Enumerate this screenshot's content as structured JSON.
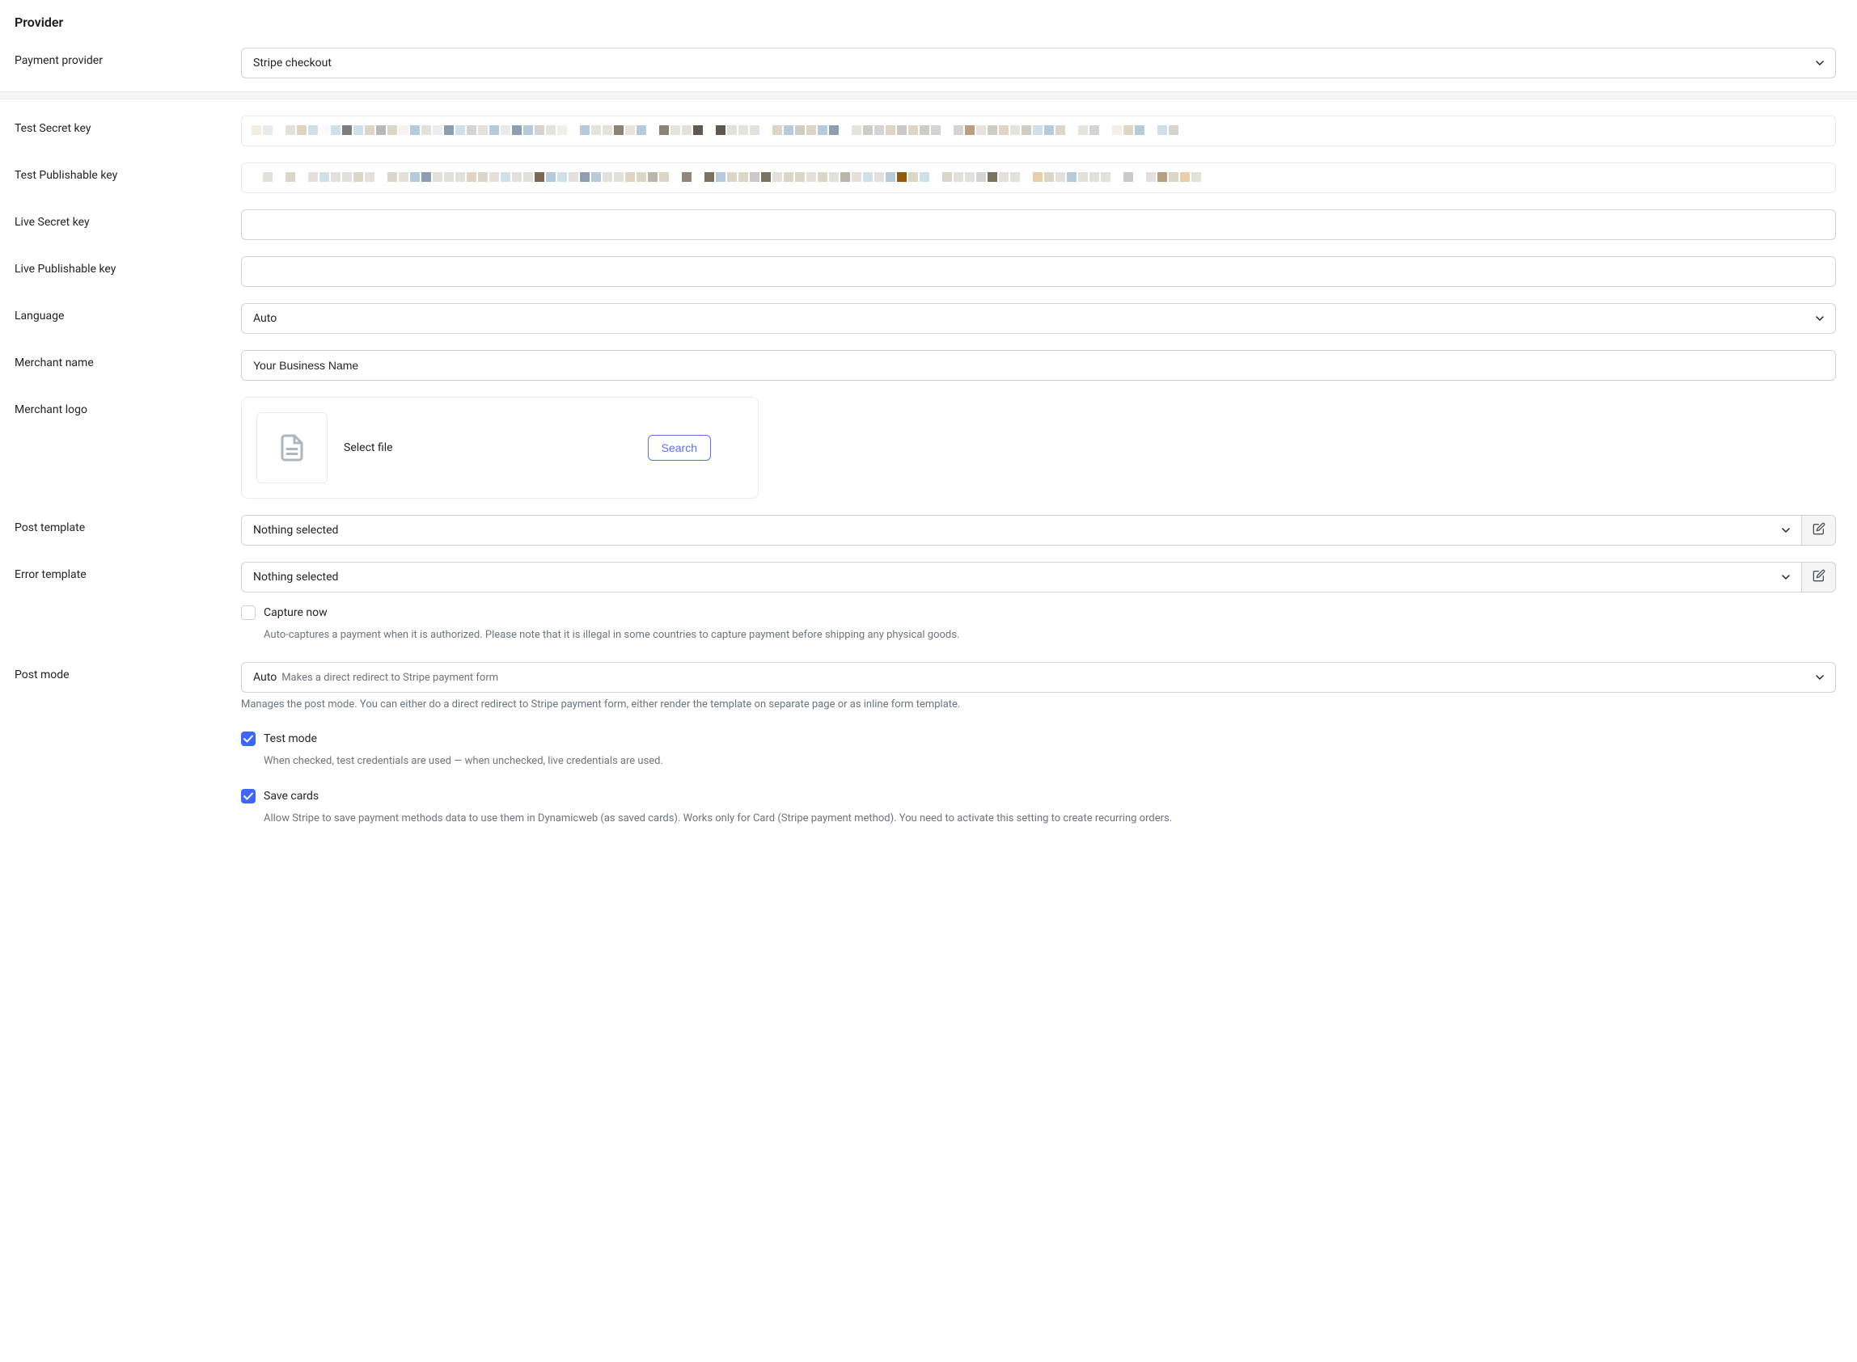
{
  "section": {
    "title": "Provider"
  },
  "fields": {
    "payment_provider": {
      "label": "Payment provider",
      "value": "Stripe checkout"
    },
    "test_secret_key": {
      "label": "Test Secret key"
    },
    "test_publishable_key": {
      "label": "Test Publishable key"
    },
    "live_secret_key": {
      "label": "Live Secret key",
      "value": ""
    },
    "live_publishable_key": {
      "label": "Live Publishable key",
      "value": ""
    },
    "language": {
      "label": "Language",
      "value": "Auto"
    },
    "merchant_name": {
      "label": "Merchant name",
      "value": "Your Business Name"
    },
    "merchant_logo": {
      "label": "Merchant logo",
      "placeholder": "Select file",
      "search_button": "Search"
    },
    "post_template": {
      "label": "Post template",
      "value": "Nothing selected"
    },
    "error_template": {
      "label": "Error template",
      "value": "Nothing selected"
    },
    "capture_now": {
      "label": "Capture now",
      "checked": false,
      "help": "Auto-captures a payment when it is authorized. Please note that it is illegal in some countries to capture payment before shipping any physical goods."
    },
    "post_mode": {
      "label": "Post mode",
      "value": "Auto",
      "subtext": "Makes a direct redirect to Stripe payment form",
      "help": "Manages the post mode. You can either do a direct redirect to Stripe payment form, either render the template on separate page or as inline form template."
    },
    "test_mode": {
      "label": "Test mode",
      "checked": true,
      "help": "When checked, test credentials are used — when unchecked, live credentials are used."
    },
    "save_cards": {
      "label": "Save cards",
      "checked": true,
      "help": "Allow Stripe to save payment methods data to use them in Dynamicweb (as saved cards). Works only for Card (Stripe payment method). You need to activate this setting to create recurring orders."
    }
  },
  "pixel_colors_1": [
    "#f3ece3",
    "#eaeaea",
    "#ffffff",
    "#e4e1dc",
    "#dfd2bf",
    "#cfe0ea",
    "#fafafa",
    "#cfe0ea",
    "#7d7d7d",
    "#cfe0ea",
    "#dcd6c8",
    "#b9b8b8",
    "#dcd6c8",
    "#f3f3f3",
    "#b5cadb",
    "#e4e1dc",
    "#ededed",
    "#8f9db3",
    "#cfe0ea",
    "#d6d4d3",
    "#e4e1dc",
    "#b5cadb",
    "#eaeaea",
    "#8f9db3",
    "#b5cadb",
    "#d6d4d3",
    "#e6e3dc",
    "#f2efe9",
    "#ffffff",
    "#b5cadb",
    "#e6e3dc",
    "#e6e3dc",
    "#8e8276",
    "#e6e3dc",
    "#b5cadb",
    "#ffffff",
    "#8e8276",
    "#e6e3dc",
    "#e4e1dc",
    "#5f5950",
    "#ffffff",
    "#5f5950",
    "#e4e1dc",
    "#e6e3dc",
    "#e4e1dc",
    "#ffffff",
    "#dcd4c6",
    "#b5cadb",
    "#cfccc6",
    "#dcd4c6",
    "#b5cadb",
    "#8f9db3",
    "#ffffff",
    "#e6e3dc",
    "#cfccc6",
    "#d6d4d3",
    "#e0d5c3",
    "#c9c9c9",
    "#e0d5c3",
    "#cfccc6",
    "#d6d4d3",
    "#ffffff",
    "#d6d4d3",
    "#b99f80",
    "#e6e3dc",
    "#cfccc6",
    "#e0d5c3",
    "#e6e3dc",
    "#cfccc6",
    "#cfe0ea",
    "#b5cadb",
    "#dcd6c8",
    "#ffffff",
    "#e6e3dc",
    "#d6d4d3",
    "#ffffff",
    "#f2efe9",
    "#e0d5c3",
    "#b5cadb",
    "#ffffff",
    "#cfe0ea",
    "#d6d4d3"
  ],
  "pixel_colors_2": [
    "#ffffff",
    "#e4e1dc",
    "#ffffff",
    "#dcd6c8",
    "#ffffff",
    "#e4e1dc",
    "#cfe0ea",
    "#e4e1dc",
    "#e4e1dc",
    "#dcd6c8",
    "#e4e1dc",
    "#ffffff",
    "#dcd6c8",
    "#e4e1dc",
    "#b5cadb",
    "#8f9db3",
    "#e4e1dc",
    "#e4e1dc",
    "#e4e1dc",
    "#e0d5c3",
    "#dcd6c8",
    "#e4e1dc",
    "#cfe0ea",
    "#e4e1dc",
    "#e4e1dc",
    "#7c6850",
    "#b5cadb",
    "#cfe0ea",
    "#e4e1dc",
    "#8f9db3",
    "#b5cadb",
    "#e4e1dc",
    "#e4e1dc",
    "#e0d5c3",
    "#dcd6c8",
    "#bcb5a9",
    "#dcd6c8",
    "#ffffff",
    "#90867a",
    "#ffffff",
    "#7a715f",
    "#b5cadb",
    "#dcd6c8",
    "#dcd6c8",
    "#c9c9c9",
    "#7a715f",
    "#e4e1dc",
    "#dcd6c8",
    "#dcd6c8",
    "#e4e1dc",
    "#dcd6c8",
    "#e4e1dc",
    "#bcb5a9",
    "#e4e1dc",
    "#cfe0ea",
    "#e4e1dc",
    "#b5cadb",
    "#925a0a",
    "#dcd6c8",
    "#cfe0ea",
    "#ffffff",
    "#dcd6c8",
    "#e4e1dc",
    "#e4e1dc",
    "#d6d4d3",
    "#7a715f",
    "#e4e1dc",
    "#e4e1dc",
    "#ffffff",
    "#e8cfa6",
    "#dcd6c8",
    "#e4e1dc",
    "#b5cadb",
    "#e4e1dc",
    "#e4e1dc",
    "#e4e1dc",
    "#ffffff",
    "#c9c9c9",
    "#ffffff",
    "#e4e1dc",
    "#b99f80",
    "#dcd6c8",
    "#e8cfa6",
    "#e4e1dc"
  ]
}
